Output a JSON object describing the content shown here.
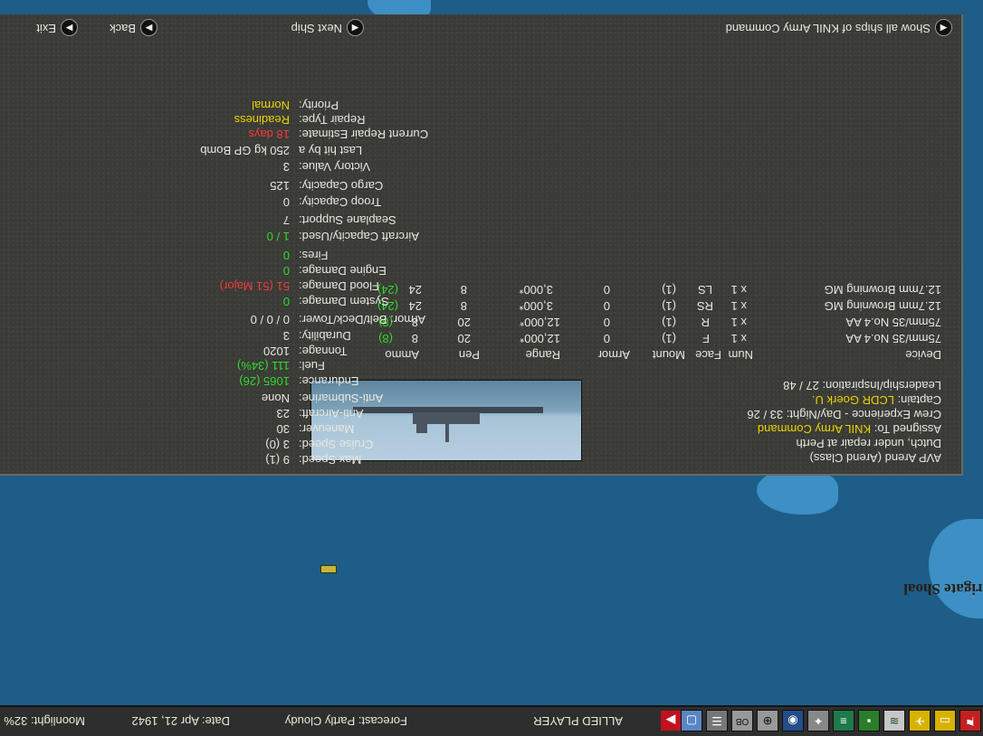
{
  "map": {
    "place_label": "Frigate Shoal"
  },
  "toolbar": {
    "icons": [
      "flag-icon",
      "ship-icon",
      "plane-icon",
      "sub-icon",
      "base-icon",
      "convoy-icon",
      "air-group-icon",
      "globe-icon",
      "target-icon",
      "oob-icon",
      "list-icon",
      "screen-icon"
    ],
    "player": "ALLIED PLAYER",
    "forecast_label": "Forecast:",
    "forecast": "Partly Cloudy",
    "date_label": "Date:",
    "date": "Apr 21, 1942",
    "moonlight_label": "Moonlight:",
    "moonlight": "32%"
  },
  "ship": {
    "name": "AVP Arend (Arend Class)",
    "status": "Dutch, under repair at Perth",
    "assigned_label": "Assigned To:",
    "assigned": "KNIL Army Command",
    "crew_exp": "Crew Experience - Day/Night: 33 / 26",
    "captain_label": "Captain:",
    "captain": "LCDR Goerk U.",
    "leadership": "Leadership/Inspiration: 27 / 48"
  },
  "device_table": {
    "headers": [
      "Device",
      "Num",
      "Face",
      "Mount",
      "Armor",
      "Range",
      "Pen",
      "Ammo"
    ],
    "rows": [
      {
        "device": "75mm/35 No.4 AA",
        "num": "x 1",
        "face": "F",
        "mount": "(1)",
        "armor": "0",
        "range": "12,000*",
        "pen": "20",
        "ammo": "8",
        "ammo_extra": "(8)"
      },
      {
        "device": "75mm/35 No.4 AA",
        "num": "x 1",
        "face": "R",
        "mount": "(1)",
        "armor": "0",
        "range": "12,000*",
        "pen": "20",
        "ammo": "8",
        "ammo_extra": "(8)"
      },
      {
        "device": "12.7mm Browning MG",
        "num": "x 1",
        "face": "RS",
        "mount": "(1)",
        "armor": "0",
        "range": "3,000*",
        "pen": "8",
        "ammo": "24",
        "ammo_extra": "(24)"
      },
      {
        "device": "12.7mm Browning MG",
        "num": "x 1",
        "face": "LS",
        "mount": "(1)",
        "armor": "0",
        "range": "3,000*",
        "pen": "8",
        "ammo": "24",
        "ammo_extra": "(24)"
      }
    ]
  },
  "stats": [
    {
      "label": "Max Speed:",
      "value": "9 (1)",
      "color": "w"
    },
    {
      "label": "Cruise Speed:",
      "value": "3 (0)",
      "color": "w"
    },
    {
      "label": "Maneuver:",
      "value": "30",
      "color": "w"
    },
    {
      "label": "Anti-Aircraft:",
      "value": "23",
      "color": "w"
    },
    {
      "label": "Anti-Submarine:",
      "value": "None",
      "color": "w"
    },
    {
      "label": "Endurance:",
      "value": "1065 (26)",
      "color": "g"
    },
    {
      "label": "Fuel:",
      "value": "111 (34%)",
      "color": "g"
    },
    {
      "label": "Tonnage:",
      "value": "1020",
      "color": "w"
    },
    {
      "label": "Durability:",
      "value": "3",
      "color": "w"
    },
    {
      "label": "Armor: Belt/Deck/Tower:",
      "value": "0 / 0 / 0",
      "color": "w"
    },
    {
      "label": "System Damage:",
      "value": "0",
      "color": "g"
    },
    {
      "label": "Flood Damage:",
      "value": "51 (51 Major)",
      "color": "r"
    },
    {
      "label": "Engine Damage:",
      "value": "0",
      "color": "g"
    },
    {
      "label": "Fires:",
      "value": "0",
      "color": "g"
    },
    {
      "label": "Aircraft Capacity/Used:",
      "value": "1 / 0",
      "color": "g"
    },
    {
      "label": "Seaplane Support:",
      "value": "7",
      "color": "w"
    },
    {
      "label": "Troop Capacity:",
      "value": "0",
      "color": "w"
    },
    {
      "label": "Cargo Capacity:",
      "value": "125",
      "color": "w"
    },
    {
      "label": "Victory Value:",
      "value": "3",
      "color": "w"
    },
    {
      "label": "Last hit by a",
      "value": "250 kg GP Bomb",
      "color": "w"
    },
    {
      "label": "Current Repair Estimate:",
      "value": "18 days",
      "color": "r"
    },
    {
      "label": "Repair Type:",
      "value": "Readiness",
      "color": "y"
    },
    {
      "label": "Priority:",
      "value": "Normal",
      "color": "y"
    }
  ],
  "nav": {
    "show_all": "Show all ships of KNIL Army Command",
    "next_ship": "Next Ship",
    "back": "Back",
    "exit": "Exit"
  }
}
